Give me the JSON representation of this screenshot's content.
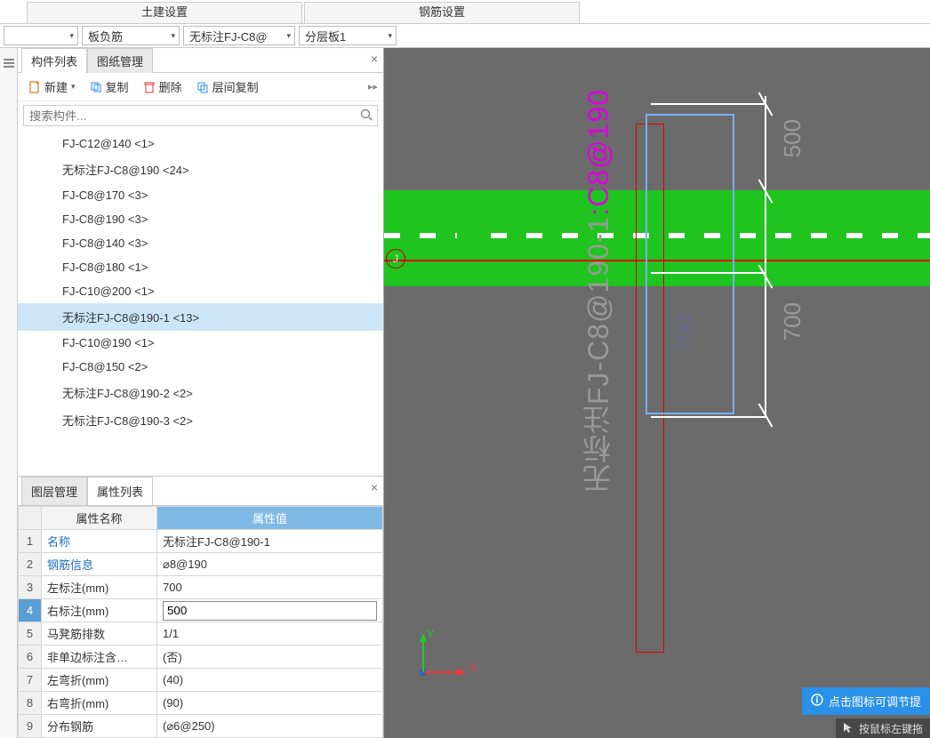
{
  "top_tabs": {
    "tab1": "土建设置",
    "tab2": "钢筋设置"
  },
  "selectors": {
    "sel0": "",
    "sel1": "板负筋",
    "sel2": "无标注FJ-C8@",
    "sel3": "分层板1"
  },
  "panel": {
    "tab_components": "构件列表",
    "tab_drawings": "图纸管理",
    "toolbar": {
      "new": "新建",
      "copy": "复制",
      "delete": "删除",
      "floorcopy": "层间复制"
    },
    "search_placeholder": "搜索构件...",
    "items": [
      "FJ-C12@140 <1>",
      "无标注FJ-C8@190 <24>",
      "FJ-C8@170 <3>",
      "FJ-C8@190 <3>",
      "FJ-C8@140 <3>",
      "FJ-C8@180 <1>",
      "FJ-C10@200 <1>",
      "无标注FJ-C8@190-1 <13>",
      "FJ-C10@190 <1>",
      "FJ-C8@150 <2>",
      "无标注FJ-C8@190-2 <2>",
      "无标注FJ-C8@190-3 <2>"
    ],
    "selected_index": 7
  },
  "prop": {
    "tab_layers": "图层管理",
    "tab_props": "属性列表",
    "header_name": "属性名称",
    "header_value": "属性值",
    "rows": [
      {
        "idx": "1",
        "name": "名称",
        "value": "无标注FJ-C8@190-1",
        "link": true
      },
      {
        "idx": "2",
        "name": "钢筋信息",
        "value": "⌀8@190",
        "link": true
      },
      {
        "idx": "3",
        "name": "左标注(mm)",
        "value": "700"
      },
      {
        "idx": "4",
        "name": "右标注(mm)",
        "value": "500",
        "editing": true
      },
      {
        "idx": "5",
        "name": "马凳筋排数",
        "value": "1/1"
      },
      {
        "idx": "6",
        "name": "非单边标注含…",
        "value": "(否)"
      },
      {
        "idx": "7",
        "name": "左弯折(mm)",
        "value": "(40)"
      },
      {
        "idx": "8",
        "name": "右弯折(mm)",
        "value": "(90)"
      },
      {
        "idx": "9",
        "name": "分布钢筋",
        "value": "(⌀6@250)"
      }
    ]
  },
  "canvas": {
    "axis_x": "X",
    "axis_y": "Y",
    "joint_label": "J",
    "dim_500": "500",
    "dim_700": "700",
    "rebar_label_prefix": "无标注FJ-C8@190-1",
    "rebar_label_hi": ":C8@190",
    "tip": "点击图标可调节提",
    "status": "按鼠标左键拖"
  }
}
